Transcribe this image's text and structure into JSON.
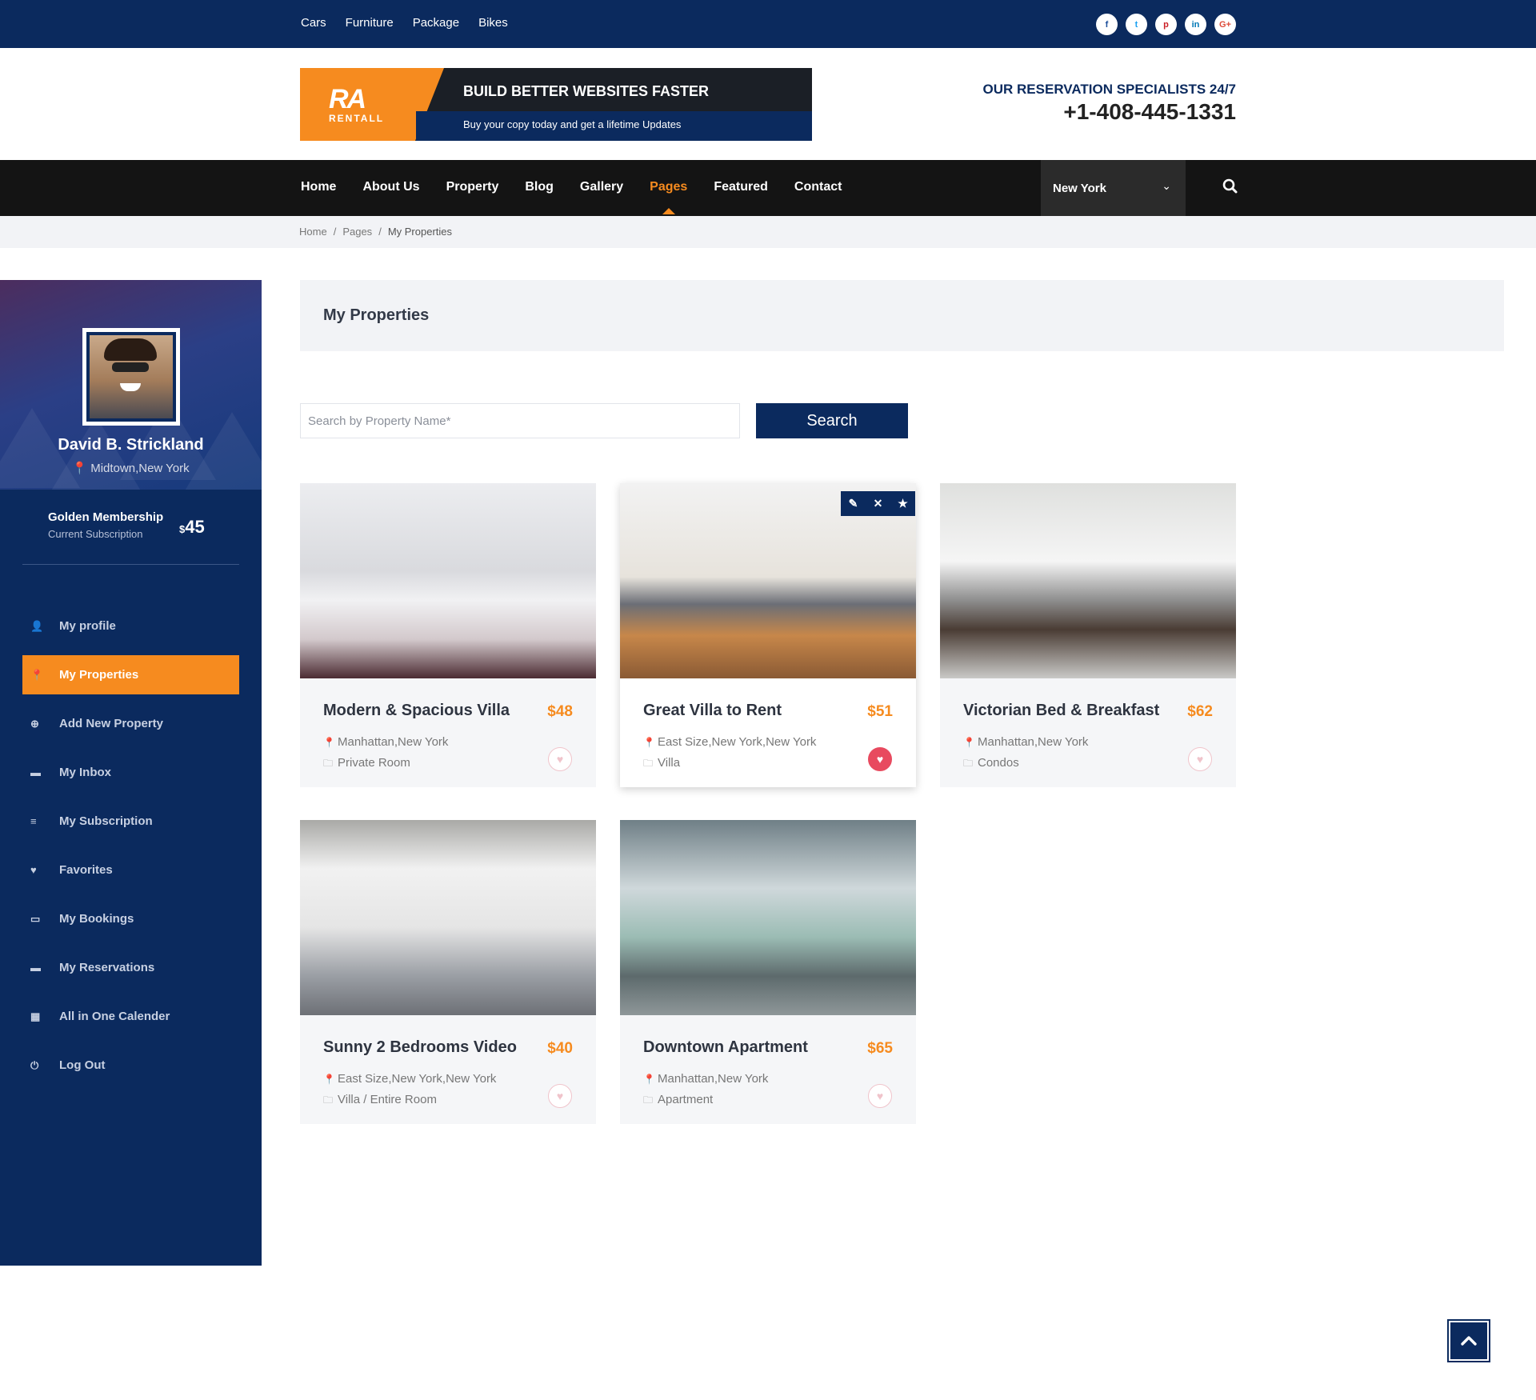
{
  "topbar": {
    "links": [
      "Cars",
      "Furniture",
      "Package",
      "Bikes"
    ],
    "socials": [
      {
        "icon": "facebook-icon",
        "glyph": "f",
        "color": "#1b4e9b"
      },
      {
        "icon": "twitter-icon",
        "glyph": "t",
        "color": "#1da1f2"
      },
      {
        "icon": "pinterest-icon",
        "glyph": "p",
        "color": "#cb2027"
      },
      {
        "icon": "linkedin-icon",
        "glyph": "in",
        "color": "#0077b5"
      },
      {
        "icon": "google-plus-icon",
        "glyph": "G+",
        "color": "#dd4b39"
      }
    ]
  },
  "banner": {
    "logo_mark": "RA",
    "logo_text": "RENTALL",
    "title": "BUILD BETTER WEBSITES FASTER",
    "subtitle": "Buy your copy today and get a lifetime Updates"
  },
  "reservation": {
    "label": "OUR RESERVATION SPECIALISTS 24/7",
    "phone": "+1-408-445-1331"
  },
  "nav": {
    "items": [
      {
        "label": "Home",
        "active": false
      },
      {
        "label": "About Us",
        "active": false
      },
      {
        "label": "Property",
        "active": false
      },
      {
        "label": "Blog",
        "active": false
      },
      {
        "label": "Gallery",
        "active": false
      },
      {
        "label": "Pages",
        "active": true
      },
      {
        "label": "Featured",
        "active": false
      },
      {
        "label": "Contact",
        "active": false
      }
    ],
    "city": "New York"
  },
  "breadcrumb": {
    "items": [
      "Home",
      "Pages",
      "My Properties"
    ]
  },
  "profile": {
    "name": "David B. Strickland",
    "location": "Midtown,New York",
    "membership_title": "Golden Membership",
    "membership_sub": "Current Subscription",
    "price_currency": "$",
    "price_value": "45"
  },
  "sidebar_menu": [
    {
      "label": "My profile",
      "icon": "user-icon",
      "glyph": "👤",
      "active": false
    },
    {
      "label": "My Properties",
      "icon": "map-pin-icon",
      "glyph": "📍",
      "active": true
    },
    {
      "label": "Add New Property",
      "icon": "plus-circle-icon",
      "glyph": "⊕",
      "active": false
    },
    {
      "label": "My Inbox",
      "icon": "inbox-icon",
      "glyph": "▬",
      "active": false
    },
    {
      "label": "My Subscription",
      "icon": "list-icon",
      "glyph": "≡",
      "active": false
    },
    {
      "label": "Favorites",
      "icon": "heart-icon",
      "glyph": "♥",
      "active": false
    },
    {
      "label": "My Bookings",
      "icon": "folder-open-icon",
      "glyph": "▭",
      "active": false
    },
    {
      "label": "My Reservations",
      "icon": "folder-icon",
      "glyph": "▬",
      "active": false
    },
    {
      "label": "All in One Calender",
      "icon": "calendar-icon",
      "glyph": "▦",
      "active": false
    },
    {
      "label": "Log Out",
      "icon": "power-icon",
      "glyph": "⏻",
      "active": false
    }
  ],
  "main": {
    "title": "My Properties",
    "search_placeholder": "Search by Property Name*",
    "search_button": "Search"
  },
  "properties": [
    {
      "title": "Modern & Spacious Villa",
      "price": "$48",
      "location": "Manhattan,New York",
      "type": "Private Room",
      "favorited": false,
      "photo": "ph1"
    },
    {
      "title": "Great Villa to Rent",
      "price": "$51",
      "location": "East Size,New York,New York",
      "type": "Villa",
      "favorited": true,
      "photo": "ph2",
      "tools": [
        "pencil-icon",
        "close-icon",
        "star-icon"
      ]
    },
    {
      "title": "Victorian Bed & Breakfast",
      "price": "$62",
      "location": "Manhattan,New York",
      "type": "Condos",
      "favorited": false,
      "photo": "ph3"
    },
    {
      "title": "Sunny 2 Bedrooms Video",
      "price": "$40",
      "location": "East Size,New York,New York",
      "type": "Villa / Entire Room",
      "favorited": false,
      "photo": "ph4"
    },
    {
      "title": "Downtown Apartment",
      "price": "$65",
      "location": "Manhattan,New York",
      "type": "Apartment",
      "favorited": false,
      "photo": "ph5"
    }
  ],
  "colors": {
    "navy": "#0b2a5e",
    "orange": "#f68b1f",
    "nav_dark": "#141414",
    "heart_red": "#e84a5f"
  }
}
